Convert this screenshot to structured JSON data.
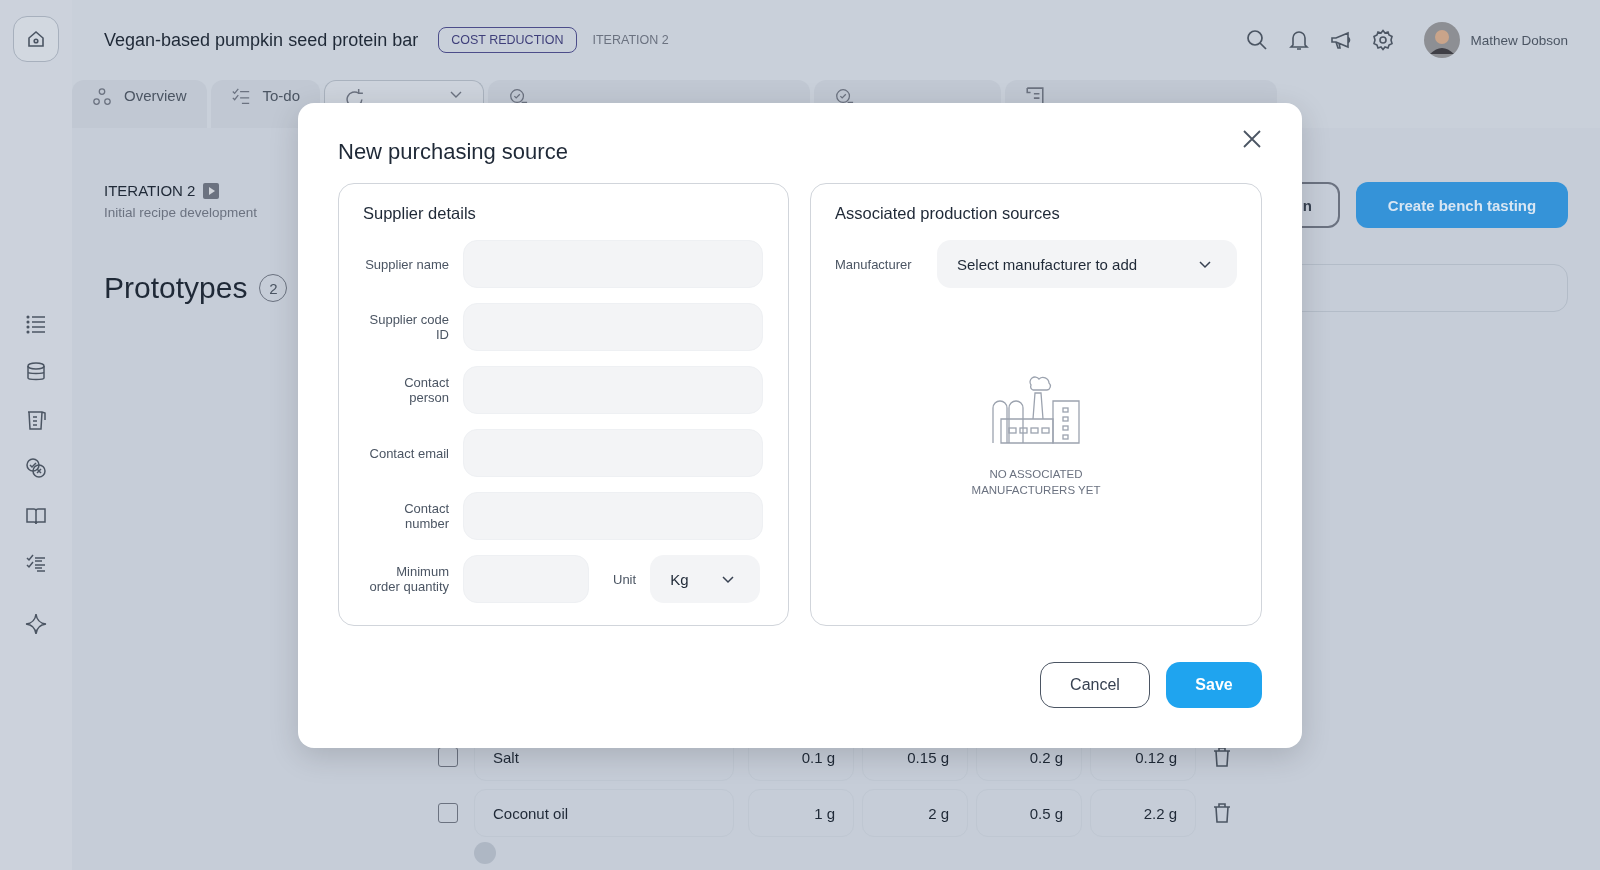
{
  "header": {
    "title": "Vegan-based pumpkin seed protein bar",
    "tag": "COST REDUCTION",
    "iteration": "ITERATION 2",
    "user_name": "Mathew Dobson"
  },
  "tabs": [
    {
      "label": "Overview",
      "selected": false
    },
    {
      "label": "To-do",
      "selected": false
    },
    {
      "selected": true
    },
    {
      "selected": false
    },
    {
      "selected": false
    },
    {
      "selected": false
    }
  ],
  "iteration": {
    "label": "ITERATION 2",
    "subtitle": "Initial recipe development"
  },
  "section": {
    "title": "Prototypes",
    "count": "2"
  },
  "actions": [
    {
      "label": "n",
      "kind": "outline"
    },
    {
      "label": "Create bench tasting",
      "kind": "primary"
    }
  ],
  "ingredients": [
    {
      "name": "Salt",
      "checked": false,
      "amounts": [
        "0.1 g",
        "0.15 g",
        "0.2 g",
        "0.12 g"
      ]
    },
    {
      "name": "Coconut oil",
      "checked": false,
      "amounts": [
        "1 g",
        "2 g",
        "0.5 g",
        "2.2 g"
      ]
    }
  ],
  "modal": {
    "title": "New purchasing source",
    "supplier": {
      "title": "Supplier details",
      "fields": [
        {
          "label": "Supplier name"
        },
        {
          "label": "Supplier code ID"
        },
        {
          "label": "Contact person"
        },
        {
          "label": "Contact email"
        },
        {
          "label": "Contact number"
        }
      ],
      "min_order": {
        "label": "Minimum order quantity"
      },
      "unit": {
        "label": "Unit",
        "value": "Kg"
      }
    },
    "production": {
      "title": "Associated production sources",
      "manufacturer": {
        "label": "Manufacturer",
        "value": "Select manufacturer to add"
      },
      "empty_text": "NO ASSOCIATED MANUFACTURERS YET"
    },
    "buttons": [
      {
        "label": "Cancel",
        "kind": "secondary"
      },
      {
        "label": "Save",
        "kind": "primary"
      }
    ]
  }
}
